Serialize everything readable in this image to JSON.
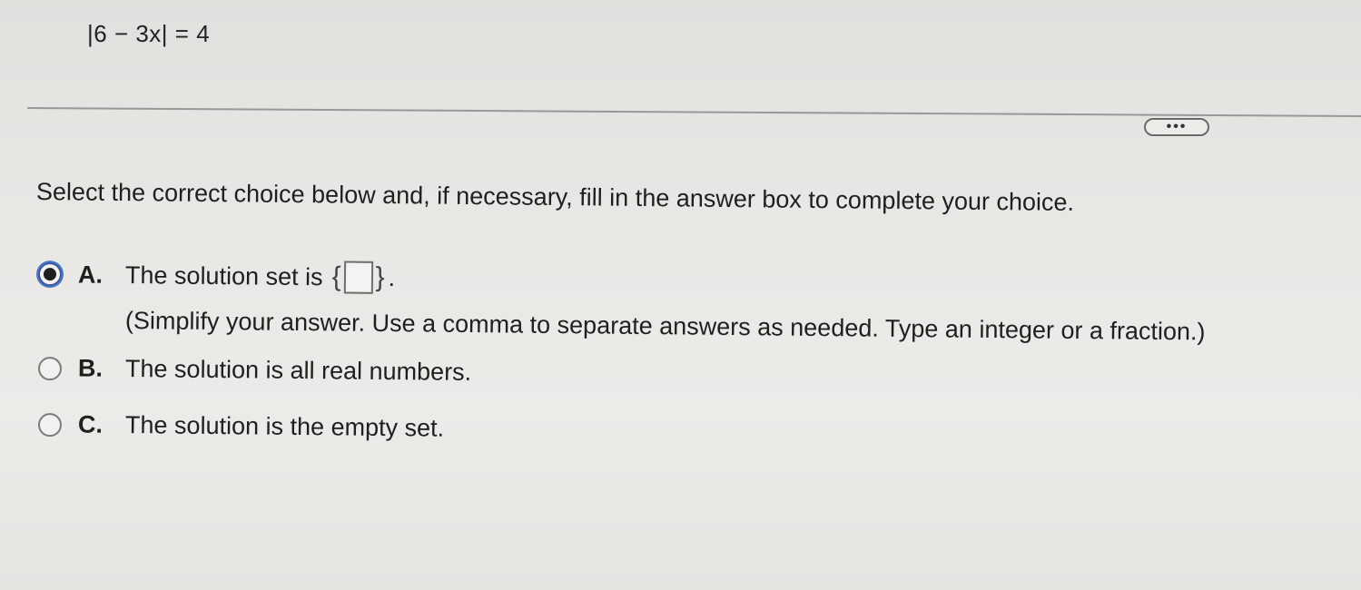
{
  "problem": {
    "equation": "|6 − 3x| = 4"
  },
  "toolbar": {
    "more_label": "•••"
  },
  "instruction": "Select the correct choice below and, if necessary, fill in the answer box to complete your choice.",
  "choices": [
    {
      "letter": "A.",
      "text": "The solution set is",
      "brace_open": "{",
      "brace_close": "}",
      "suffix": ".",
      "hint": "(Simplify your answer. Use a comma to separate answers as needed. Type an integer or a fraction.)",
      "selected": true,
      "answer_value": ""
    },
    {
      "letter": "B.",
      "text": "The solution is all real numbers.",
      "selected": false
    },
    {
      "letter": "C.",
      "text": "The solution is the empty set.",
      "selected": false
    }
  ],
  "colors": {
    "selected_ring": "#4b78c9",
    "background": "#e9e7e4"
  }
}
